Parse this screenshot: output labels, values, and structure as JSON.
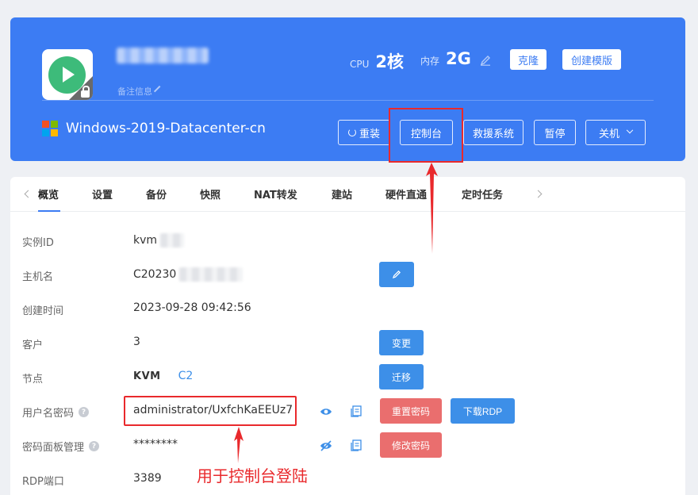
{
  "header": {
    "remark_label": "备注信息",
    "cpu_label": "CPU",
    "cpu_value": "2核",
    "mem_label": "内存",
    "mem_value": "2G",
    "clone_label": "克隆",
    "create_template_label": "创建模版",
    "os_name": "Windows-2019-Datacenter-cn",
    "actions": {
      "reinstall": "重装",
      "console": "控制台",
      "rescue": "救援系统",
      "pause": "暂停",
      "shutdown": "关机"
    }
  },
  "tabs": [
    "概览",
    "设置",
    "备份",
    "快照",
    "NAT转发",
    "建站",
    "硬件直通",
    "定时任务"
  ],
  "details": {
    "instance_id_label": "实例ID",
    "instance_id_value": "kvm",
    "hostname_label": "主机名",
    "hostname_value": "C20230",
    "created_label": "创建时间",
    "created_value": "2023-09-28 09:42:56",
    "client_label": "客户",
    "client_value": "3",
    "node_label": "节点",
    "node_logo": "KVM",
    "node_value": "C2",
    "credentials_label": "用户名密码",
    "credentials_value": "administrator/UxfchKaEEUz7",
    "panel_pwd_label": "密码面板管理",
    "panel_pwd_value": "********",
    "rdp_label": "RDP端口",
    "rdp_value": "3389"
  },
  "buttons": {
    "change": "变更",
    "migrate": "迁移",
    "reset_password": "重置密码",
    "download_rdp": "下载RDP",
    "modify_password": "修改密码"
  },
  "annotation": "用于控制台登陆",
  "colors": {
    "primary": "#3c7cf3",
    "danger": "#ea6e6e",
    "highlight": "#e9292c"
  }
}
